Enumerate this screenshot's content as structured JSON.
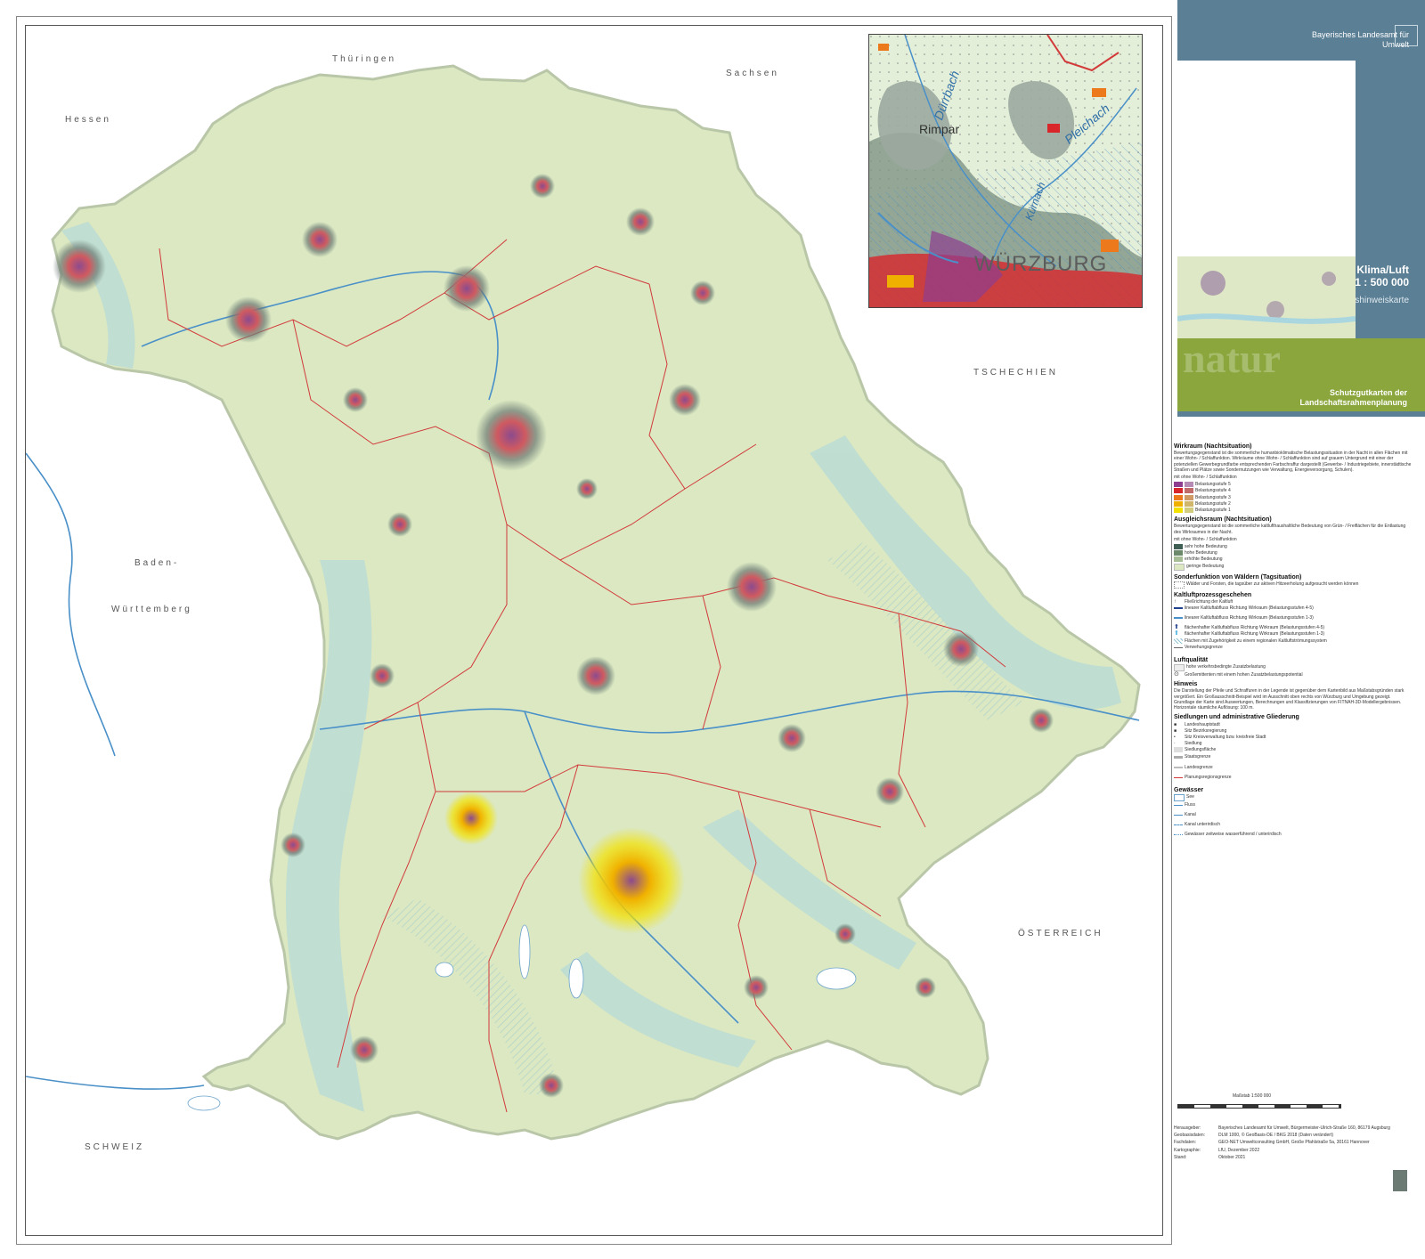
{
  "header": {
    "agency_line1": "Bayerisches Landesamt für",
    "agency_line2": "Umwelt",
    "logo_icon": "bavaria-crest-icon"
  },
  "title": {
    "main": "Schutzgutkarte Klima/Luft",
    "scale": "1 : 500 000",
    "subtitle": "Planungshinweiskarte",
    "series_word": "natur",
    "series_line1": "Schutzgutkarten der",
    "series_line2": "Landschaftsrahmenplanung"
  },
  "map": {
    "countries": {
      "thueringen": "Thüringen",
      "sachsen": "Sachsen",
      "hessen": "Hessen",
      "tschechien": "TSCHECHIEN",
      "baden": "Baden-",
      "wuerttemberg": "Württemberg",
      "oesterreich": "ÖSTERREICH",
      "schweiz": "SCHWEIZ"
    },
    "colors": {
      "land": "#dbe8c2",
      "air_corridor": "#a9d6df",
      "planning_border": "#d23a3a",
      "settlement": "#8c4b8e",
      "outside": "#ffffff"
    }
  },
  "inset": {
    "labels": {
      "duerrbach": "Dürrbach",
      "pleichach": "Pleichach",
      "rimpar": "Rimpar",
      "kuernach": "Kürnach",
      "wuerzburg": "WÜRZBURG"
    }
  },
  "legend": {
    "wirkraum": {
      "title": "Wirkraum (Nachtsituation)",
      "desc": "Bewertungsgegenstand ist die sommerliche humanbioklimatische Belastungssituation in der Nacht in allen Flächen mit einer Wohn- / Schlaffunktion. Wirkräume ohne Wohn- / Schlaffunktion sind auf grauem Untergrund mit einer der potenziellen Gewerbegrundfarbe entsprechenden Farbschraffur dargestellt (Gewerbe- / Industriegebiete, innerstädtische Straßen und Plätze sowie Sondernutzungen wie Verwaltung, Energieversorgung, Schulen).",
      "header": "mit   ohne   Wohn- / Schlaffunktion",
      "items": [
        {
          "label": "Belastungsstufe 5",
          "color": "#8e3d8f",
          "color2": "#b58bb6"
        },
        {
          "label": "Belastungsstufe 4",
          "color": "#d8262a",
          "color2": "#c06a6a"
        },
        {
          "label": "Belastungsstufe 3",
          "color": "#ec7a1c",
          "color2": "#cf9a66"
        },
        {
          "label": "Belastungsstufe 2",
          "color": "#f0b000",
          "color2": "#cfb66a"
        },
        {
          "label": "Belastungsstufe 1",
          "color": "#f3e200",
          "color2": "#d2cc80"
        }
      ]
    },
    "ausgleich": {
      "title": "Ausgleichsraum (Nachtsituation)",
      "desc": "Bewertungsgegenstand ist die sommerliche kaltlufthaushaltliche Bedeutung von Grün- / Freiflächen für die Entlastung des Wirkraumes in der Nacht.",
      "header": "mit   ohne   Wohn- / Schlaffunktion",
      "items": [
        {
          "label": "sehr hohe Bedeutung",
          "color": "#3f5f55"
        },
        {
          "label": "hohe Bedeutung",
          "color": "#6c8a6b"
        },
        {
          "label": "erhöhte Bedeutung",
          "color": "#a7bd95"
        },
        {
          "label": "geringe Bedeutung",
          "color": "#dbe8c2"
        }
      ]
    },
    "wald": {
      "title": "Sonderfunktion von Wäldern (Tagsituation)",
      "item": "Wälder und Forsten, die tagsüber zur aktiven Hitzeerholung aufgesucht werden können"
    },
    "kaltluft": {
      "title": "Kaltluftprozessgeschehen",
      "items": [
        "Fließrichtung der Kaltluft",
        "linearer Kaltluftabfluss Richtung Wirkraum (Belastungsstufen 4-5)",
        "linearer Kaltluftabfluss Richtung Wirkraum (Belastungsstufen 1-3)",
        "flächenhafter Kaltluftabfluss Richtung Wirkraum (Belastungsstufen 4-5)",
        "flächenhafter Kaltluftabfluss Richtung Wirkraum (Belastungsstufen 1-3)",
        "Flächen mit Zugehörigkeit zu einem regionalen Kaltluftströmungssystem",
        "Verwehungsgrenze"
      ]
    },
    "luft": {
      "title": "Luftqualität",
      "items": [
        "hohe verkehrsbedingte Zusatzbelastung",
        "Großemittenten mit einem hohen Zusatzbelastungspotential"
      ]
    },
    "hinweis": {
      "title": "Hinweis",
      "text": "Die Darstellung der Pfeile und Schraffuren in der Legende ist gegenüber dem Kartenbild aus Maßstabsgründen stark vergrößert. Ein Großausschnitt-Beispiel wird im Ausschnitt oben rechts von Würzburg und Umgebung gezeigt. Grundlage der Karte sind Auswertungen, Berechnungen und Klassifizierungen von FITNAH-3D-Modellergebnissen. Horizontale räumliche Auflösung: 100 m."
    },
    "siedlung": {
      "title": "Siedlungen und administrative Gliederung",
      "items": [
        "Landeshauptstadt",
        "Sitz Bezirksregierung",
        "Sitz Kreisverwaltung bzw. kreisfreie Stadt",
        "Siedlung",
        "Siedlungsfläche",
        "Staatsgrenze",
        "Landesgrenze",
        "Planungsregionsgrenze"
      ]
    },
    "gewaesser": {
      "title": "Gewässer",
      "items": [
        "See",
        "Fluss",
        "Kanal",
        "Kanal unterirdisch",
        "Gewässer zeitweise wasserführend / unterirdisch"
      ]
    }
  },
  "scale": {
    "label": "Maßstab  1:500 000"
  },
  "imprint": {
    "herausgeber_k": "Herausgeber:",
    "herausgeber_v": "Bayerisches Landesamt für Umwelt, Bürgermeister-Ulrich-Straße 160, 86179 Augsburg",
    "geobasis_k": "Geobasisdaten:",
    "geobasis_v": "DLM 1000, © GeoBasis-DE / BKG 2018 (Daten verändert)",
    "fachdaten_k": "Fachdaten:",
    "fachdaten_v": "GEO-NET Umweltconsulting GmbH, Große Pfahlstraße 5a, 30161 Hannover",
    "karto_k": "Kartographie:",
    "karto_v": "LfU, Dezember 2022",
    "stand_k": "Stand:",
    "stand_v": "Oktober 2021",
    "geonet_logo": "geo-net-logo-icon"
  }
}
